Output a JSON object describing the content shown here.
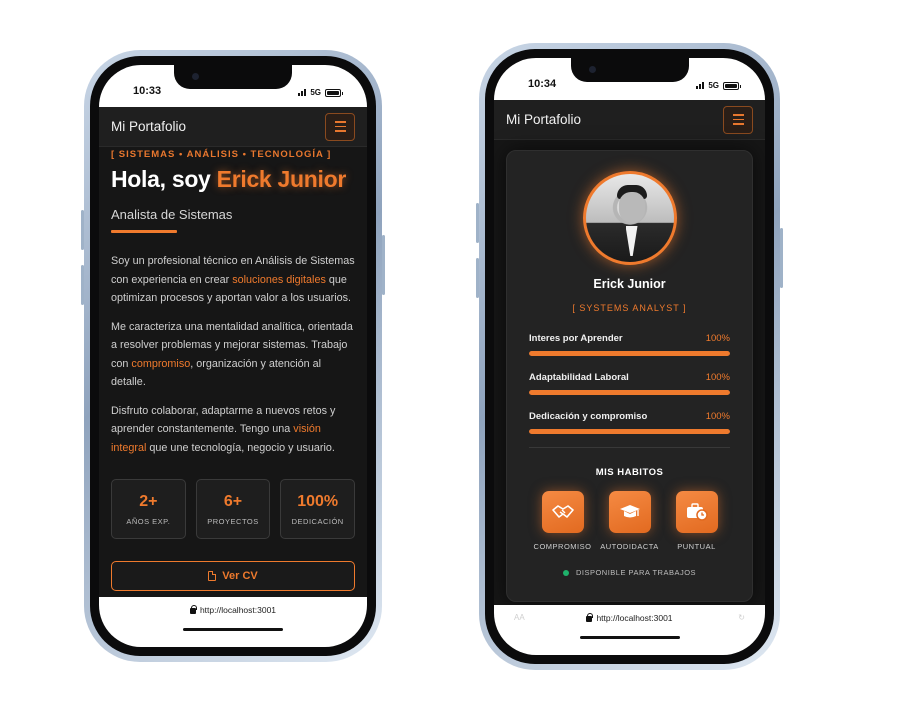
{
  "phones": [
    {
      "status": {
        "time": "10:33",
        "network": "5G"
      },
      "nav": {
        "brand": "Mi Portafolio"
      },
      "hero": {
        "tagline": "[ SISTEMAS • ANÁLISIS • TECNOLOGÍA ]",
        "greeting": "Hola, soy",
        "name": "Erick Junior",
        "role": "Analista de Sistemas"
      },
      "about": {
        "p1": [
          "Soy un profesional técnico en Análisis de Sistemas con experiencia en crear ",
          "soluciones digitales",
          " que optimizan procesos y aportan valor a los usuarios."
        ],
        "p2": [
          "Me caracteriza una mentalidad analítica, orientada a resolver problemas y mejorar sistemas. Trabajo con ",
          "compromiso",
          ", organización y atención al detalle."
        ],
        "p3": [
          "Disfruto colaborar, adaptarme a nuevos retos y aprender constantemente. Tengo una ",
          "visión integral",
          " que une tecnología, negocio y usuario."
        ]
      },
      "stats": [
        {
          "value": "2+",
          "label": "AÑOS EXP."
        },
        {
          "value": "6+",
          "label": "PROYECTOS"
        },
        {
          "value": "100%",
          "label": "DEDICACIÓN"
        }
      ],
      "cv_button": "Ver CV",
      "url": "http://localhost:3001"
    },
    {
      "status": {
        "time": "10:34",
        "network": "5G"
      },
      "nav": {
        "brand": "Mi Portafolio"
      },
      "profile": {
        "name": "Erick Junior",
        "role": "[ SYSTEMS ANALYST ]"
      },
      "skills": [
        {
          "name": "Interes por Aprender",
          "value": "100%",
          "level": 1.0
        },
        {
          "name": "Adaptabilidad Laboral",
          "value": "100%",
          "level": 1.0
        },
        {
          "name": "Dedicación y compromiso",
          "value": "100%",
          "level": 1.0
        }
      ],
      "habits_title": "MIS HABITOS",
      "habits": [
        {
          "label": "COMPROMISO",
          "icon": "handshake-icon"
        },
        {
          "label": "AUTODIDACTA",
          "icon": "graduation-cap-icon"
        },
        {
          "label": "PUNTUAL",
          "icon": "briefcase-clock-icon"
        }
      ],
      "availability": "DISPONIBLE PARA TRABAJOS",
      "url": "http://localhost:3001",
      "url_left": "AA"
    }
  ],
  "colors": {
    "accent": "#ef7a2d",
    "background": "#161616",
    "available": "#1fb26b"
  }
}
